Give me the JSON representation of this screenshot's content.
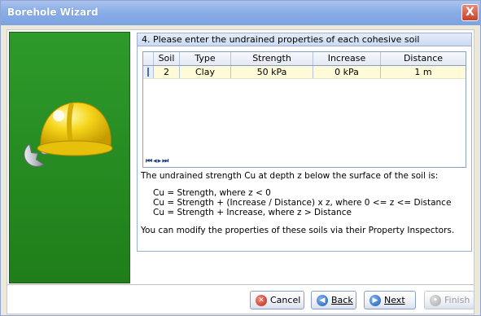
{
  "window": {
    "title": "Borehole Wizard",
    "close_label": "X"
  },
  "step": {
    "header": "4. Please enter the undrained properties of each cohesive soil"
  },
  "grid": {
    "columns": [
      "Soil",
      "Type",
      "Strength",
      "Increase",
      "Distance"
    ],
    "rows": [
      {
        "soil": "2",
        "type": "Clay",
        "strength": "50 kPa",
        "increase": "0 kPa",
        "distance": "1 m"
      }
    ],
    "nav": "⏮◂▸⏭"
  },
  "info": {
    "intro": "The undrained strength Cu at depth z below the surface of the soil is:",
    "formulas": [
      "Cu = Strength, where z < 0",
      "Cu = Strength + (Increase / Distance) x z, where 0 <= z <= Distance",
      "Cu = Strength + Increase, where z > Distance"
    ],
    "note": "You can modify the properties of these soils via their Property Inspectors."
  },
  "buttons": {
    "cancel": {
      "label": "Cancel",
      "icon": "cancel-icon"
    },
    "back": {
      "label": "Back",
      "icon": "back-arrow-icon"
    },
    "next": {
      "label": "Next",
      "icon": "next-arrow-icon"
    },
    "finish": {
      "label": "Finish",
      "icon": "finish-icon"
    }
  },
  "colors": {
    "side_panel": "#238a20",
    "title_bar": "#8aaee6",
    "grid_row_highlight": "#fffbd9"
  }
}
